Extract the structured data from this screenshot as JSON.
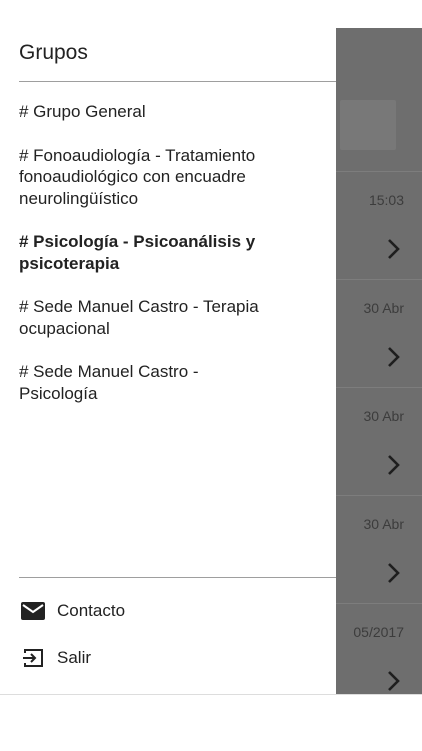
{
  "drawer": {
    "title": "Grupos",
    "groups": [
      {
        "label": "# Grupo General",
        "active": false
      },
      {
        "label": "# Fonoaudiología - Tratamiento fonoaudiológico con encuadre neurolingüístico",
        "active": false
      },
      {
        "label": "# Psicología - Psicoanálisis y psicoterapia",
        "active": true
      },
      {
        "label": "# Sede Manuel Castro - Terapia ocupacional",
        "active": false
      },
      {
        "label": "# Sede Manuel Castro - Psicología",
        "active": false
      }
    ],
    "menu": {
      "contact_label": "Contacto",
      "logout_label": "Salir"
    }
  },
  "background_list": {
    "dates": [
      "15:03",
      "30 Abr",
      "30 Abr",
      "30 Abr",
      "05/2017"
    ],
    "chevron_icon": "chevron-right-icon"
  },
  "colors": {
    "overlay": "#6e6e6e",
    "drawer_bg": "#ffffff",
    "text": "#222222"
  }
}
